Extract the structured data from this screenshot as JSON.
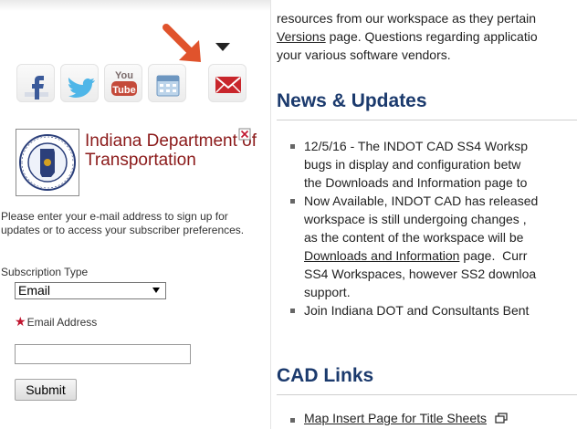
{
  "left_panel": {
    "social_icons": [
      "facebook-icon",
      "twitter-icon",
      "youtube-icon",
      "calendar-icon",
      "email-icon"
    ],
    "youtube_text": {
      "top": "You",
      "bottom": "Tube"
    },
    "agency_name": "Indiana Department of Transportation",
    "signup_text": "Please enter your e-mail address to sign up for updates or to access your subscriber preferences.",
    "subscription_type_label": "Subscription Type",
    "subscription_type_value": "Email",
    "email_label": "Email Address",
    "email_value": "",
    "submit_label": "Submit"
  },
  "content": {
    "intro_lines": [
      "resources from our workspace as they pertain",
      "page. Questions regarding applicatio",
      "your various software vendors."
    ],
    "intro_link": "Versions",
    "news_heading": "News & Updates",
    "news_items": [
      {
        "lines": [
          "12/5/16 - The INDOT CAD SS4 Worksp",
          "bugs in display and configuration betw",
          "the Downloads and Information page to"
        ]
      },
      {
        "lines": [
          "Now Available, INDOT CAD has released",
          "workspace is still undergoing changes ,",
          "as the content of the workspace will be"
        ],
        "link_text": "Downloads and Information",
        "link_after": " page.  Curr",
        "tail_lines": [
          "SS4 Workspaces, however SS2 downloa",
          "support."
        ]
      },
      {
        "lines": [
          "Join Indiana DOT and Consultants Bent"
        ]
      }
    ],
    "cad_heading": "CAD Links",
    "cad_links": [
      "Map Insert Page for Title Sheets"
    ]
  },
  "colors": {
    "heading": "#1b3a6d",
    "agency_name": "#8b1a1a",
    "required_star": "#c0152f",
    "arrow": "#e0532c"
  }
}
